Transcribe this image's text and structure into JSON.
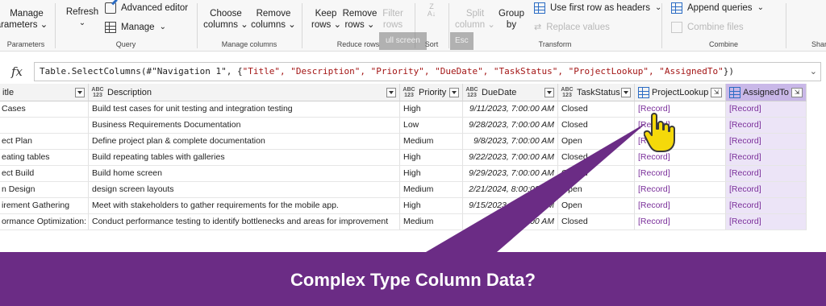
{
  "ribbon": {
    "manage_parameters": [
      "Manage",
      "arameters"
    ],
    "refresh": "Refresh",
    "advanced_editor": "Advanced editor",
    "manage": "Manage",
    "choose_columns": [
      "Choose",
      "columns"
    ],
    "remove_columns": [
      "Remove",
      "columns"
    ],
    "keep_rows": [
      "Keep",
      "rows"
    ],
    "remove_rows": [
      "Remove",
      "rows"
    ],
    "filter_rows": [
      "Filter",
      "rows"
    ],
    "split_column": [
      "Split",
      "column"
    ],
    "group_by": [
      "Group",
      "by"
    ],
    "use_first_row": "Use first row as headers",
    "replace_values": "Replace values",
    "append_queries": "Append queries",
    "combine_files": "Combine files",
    "groups": {
      "parameters": "Parameters",
      "query": "Query",
      "manage_columns": "Manage columns",
      "reduce_rows": "Reduce rows",
      "sort": "Sort",
      "transform": "Transform",
      "combine": "Combine",
      "share": "Shar"
    },
    "overlay": {
      "text": "ull screen",
      "esc": "Esc"
    }
  },
  "formula_bar": {
    "fx": "fx",
    "prefix": "Table.SelectColumns(#\"Navigation 1\", {",
    "args": "\"Title\", \"Description\", \"Priority\", \"DueDate\", \"TaskStatus\", \"ProjectLookup\", \"AssignedTo\"",
    "suffix": "})"
  },
  "grid": {
    "columns": [
      {
        "name": "itle",
        "type": ""
      },
      {
        "name": "Description",
        "type": "ABC\n123"
      },
      {
        "name": "Priority",
        "type": "ABC\n123"
      },
      {
        "name": "DueDate",
        "type": "ABC\n123"
      },
      {
        "name": "TaskStatus",
        "type": "ABC\n123"
      },
      {
        "name": "ProjectLookup",
        "type": "table"
      },
      {
        "name": "AssignedTo",
        "type": "table"
      }
    ],
    "rows": [
      [
        "Cases",
        "Build test cases for unit testing and integration testing",
        "High",
        "9/11/2023, 7:00:00 AM",
        "Closed",
        "[Record]",
        "[Record]"
      ],
      [
        "",
        "Business Requirements Documentation",
        "Low",
        "9/28/2023, 7:00:00 AM",
        "Closed",
        "[Record]",
        "[Record]"
      ],
      [
        "ect Plan",
        "Define project plan & complete documentation",
        "Medium",
        "9/8/2023, 7:00:00 AM",
        "Open",
        "[Record]",
        "[Record]"
      ],
      [
        "eating tables",
        "Build repeating tables with galleries",
        "High",
        "9/22/2023, 7:00:00 AM",
        "Closed",
        "[Record]",
        "[Record]"
      ],
      [
        "ect Build",
        "Build home screen",
        "High",
        "9/29/2023, 7:00:00 AM",
        "Closed",
        "[Record]",
        "[Record]"
      ],
      [
        "n Design",
        "design screen layouts",
        "Medium",
        "2/21/2024, 8:00:00 AM",
        "Open",
        "[Record]",
        "[Record]"
      ],
      [
        "irement Gathering",
        "Meet with stakeholders to gather requirements for the mobile app.",
        "High",
        "9/15/2023, 7:00:00 AM",
        "Open",
        "[Record]",
        "[Record]"
      ],
      [
        "ormance Optimization:",
        "Conduct performance testing to identify bottlenecks and areas for improvement",
        "Medium",
        "4, 7:00:00 AM",
        "Closed",
        "[Record]",
        "[Record]"
      ]
    ]
  },
  "banner": {
    "text": "Complex Type Column Data?"
  },
  "colors": {
    "banner": "#6b2c85",
    "record_link": "#7a2f9a",
    "selected_header": "#c9b8e8",
    "cursor": "#f5d90a"
  }
}
